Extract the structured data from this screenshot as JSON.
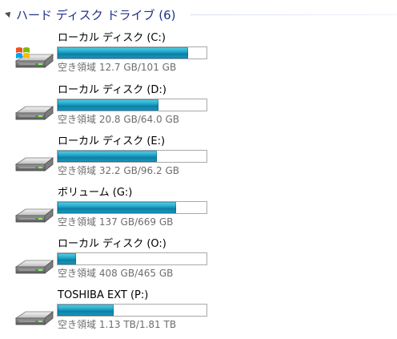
{
  "section": {
    "title": "ハード ディスク ドライブ (6)"
  },
  "drives": [
    {
      "name": "ローカル ディスク (C:)",
      "free_text": "空き領域 12.7 GB/101 GB",
      "used_fraction": 0.874,
      "icon": "windows-system-drive-icon"
    },
    {
      "name": "ローカル ディスク (D:)",
      "free_text": "空き領域 20.8 GB/64.0 GB",
      "used_fraction": 0.675,
      "icon": "hard-drive-icon"
    },
    {
      "name": "ローカル ディスク (E:)",
      "free_text": "空き領域 32.2 GB/96.2 GB",
      "used_fraction": 0.665,
      "icon": "hard-drive-icon"
    },
    {
      "name": "ボリューム (G:)",
      "free_text": "空き領域 137 GB/669 GB",
      "used_fraction": 0.795,
      "icon": "hard-drive-icon"
    },
    {
      "name": "ローカル ディスク (O:)",
      "free_text": "空き領域 408 GB/465 GB",
      "used_fraction": 0.123,
      "icon": "hard-drive-icon"
    },
    {
      "name": "TOSHIBA EXT (P:)",
      "free_text": "空き領域 1.13 TB/1.81 TB",
      "used_fraction": 0.376,
      "icon": "hard-drive-icon"
    }
  ],
  "colors": {
    "title": "#1e3287",
    "bar_fill": "#22a7c8",
    "bar_border": "#a9a9a9",
    "free_text": "#6d6d6d"
  }
}
